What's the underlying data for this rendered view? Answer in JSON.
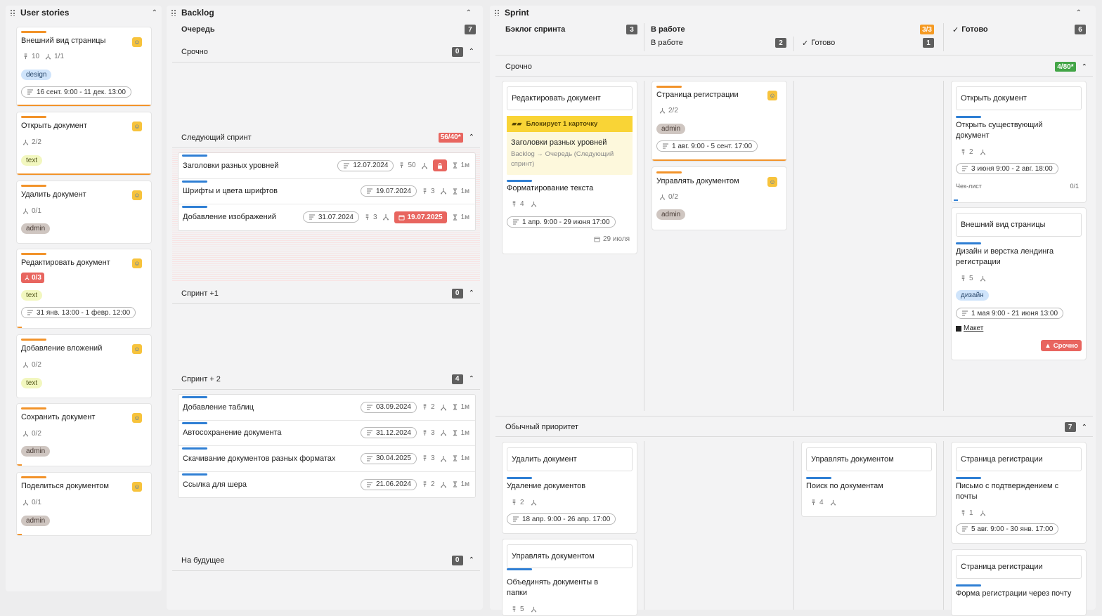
{
  "user_stories": {
    "title": "User stories",
    "cards": [
      {
        "title": "Внешний вид страницы",
        "points": "10",
        "subtasks": "1/1",
        "tag": "design",
        "period": "16 сент. 9:00 - 11 дек. 13:00"
      },
      {
        "title": "Открыть документ",
        "subtasks": "2/2",
        "tag": "text"
      },
      {
        "title": "Удалить документ",
        "subtasks": "0/1",
        "tag": "admin"
      },
      {
        "title": "Редактировать документ",
        "subtasks_badge": "0/3",
        "tag": "text",
        "period": "31 янв. 13:00 - 1 февр. 12:00"
      },
      {
        "title": "Добавление вложений",
        "subtasks": "0/2",
        "tag": "text"
      },
      {
        "title": "Сохранить документ",
        "subtasks": "0/2",
        "tag": "admin"
      },
      {
        "title": "Поделиться документом",
        "subtasks": "0/1",
        "tag": "admin"
      }
    ]
  },
  "backlog": {
    "title": "Backlog",
    "queue_label": "Очередь",
    "queue_count": "7",
    "sections": {
      "urgent": {
        "label": "Срочно",
        "count": "0"
      },
      "next_sprint": {
        "label": "Следующий спринт",
        "count": "56/40*"
      },
      "sprint1": {
        "label": "Спринт +1",
        "count": "0"
      },
      "sprint2": {
        "label": "Спринт + 2",
        "count": "4"
      },
      "future": {
        "label": "На будущее",
        "count": "0"
      }
    },
    "next_rows": [
      {
        "name": "Заголовки разных уровней",
        "date": "12.07.2024",
        "points": "50",
        "estimate": "1м"
      },
      {
        "name": "Шрифты и цвета шрифтов",
        "date": "19.07.2024",
        "points": "3",
        "estimate": "1м"
      },
      {
        "name": "Добавление изображений",
        "date": "31.07.2024",
        "points": "3",
        "deadline": "19.07.2025",
        "estimate": "1м"
      }
    ],
    "sprint2_rows": [
      {
        "name": "Добавление таблиц",
        "date": "03.09.2024",
        "points": "2",
        "estimate": "1м"
      },
      {
        "name": "Автосохранение документа",
        "date": "31.12.2024",
        "points": "3",
        "estimate": "1м"
      },
      {
        "name": "Скачивание документов разных форматах",
        "date": "30.04.2025",
        "points": "3",
        "estimate": "1м"
      },
      {
        "name": "Ссылка для шера",
        "date": "21.06.2024",
        "points": "2",
        "estimate": "1м"
      }
    ]
  },
  "sprint": {
    "title": "Sprint",
    "columns": {
      "backlog": {
        "label": "Бэклог спринта",
        "count": "3"
      },
      "in_work": {
        "label": "В работе",
        "count": "3/3"
      },
      "in_work_sub": {
        "label": "В работе",
        "count": "2"
      },
      "done_sub": {
        "label": "Готово",
        "count": "1"
      },
      "done": {
        "label": "Готово",
        "count": "6"
      }
    },
    "lanes": {
      "urgent": {
        "label": "Срочно",
        "count": "4/80*"
      },
      "normal": {
        "label": "Обычный приоритет",
        "count": "7"
      }
    },
    "c1": {
      "story": "Редактировать документ",
      "blocker": "Блокирует 1 карточку",
      "blocked_title": "Заголовки разных уровней",
      "blocked_path": "Backlog → Очередь (Следующий спринт)",
      "task": "Форматирование текста",
      "points": "4",
      "period": "1 апр. 9:00 - 29 июня 17:00",
      "due": "29 июля"
    },
    "c2": {
      "title": "Страница регистрации",
      "subtasks": "2/2",
      "tag": "admin",
      "period": "1 авг. 9:00 - 5 сент. 17:00"
    },
    "c3": {
      "title": "Управлять документом",
      "subtasks": "0/2",
      "tag": "admin"
    },
    "c4": {
      "story": "Открыть документ",
      "task": "Открыть существующий документ",
      "points": "2",
      "period": "3 июня 9:00 - 2 авг. 18:00",
      "checklist": "Чек-лист",
      "checklist_value": "0/1"
    },
    "c5": {
      "story": "Внешний вид страницы",
      "task": "Дизайн и верстка лендинга регистрации",
      "points": "5",
      "tag": "дизайн",
      "period": "1 мая 9:00 - 21 июня 13:00",
      "link": "Макет",
      "urgent": "Срочно"
    },
    "n1": {
      "story": "Удалить документ",
      "task": "Удаление документов",
      "points": "2",
      "period": "18 апр. 9:00 - 26 апр. 17:00"
    },
    "n2": {
      "story": "Управлять документом",
      "task": "Объединять документы в папки",
      "points": "5"
    },
    "n3": {
      "story": "Управлять документом",
      "task": "Поиск по документам",
      "points": "4"
    },
    "n4": {
      "story": "Страница регистрации",
      "task": "Письмо с подтверждением с почты",
      "points": "1",
      "period": "5 авг. 9:00 - 30 янв. 17:00"
    },
    "n5": {
      "story": "Страница регистрации",
      "task": "Форма регистрации через почту"
    }
  }
}
